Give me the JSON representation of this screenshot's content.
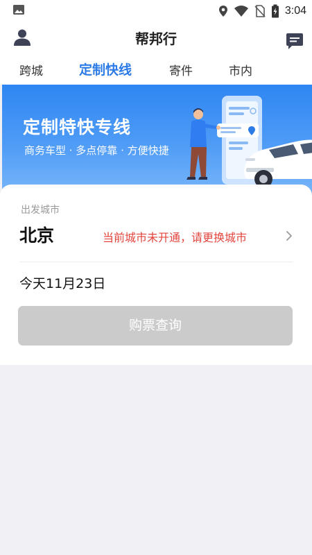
{
  "status_bar": {
    "time": "3:04",
    "icons": [
      "gallery-icon",
      "location-icon",
      "wifi-icon",
      "no-sim-icon",
      "battery-icon"
    ]
  },
  "header": {
    "title": "帮邦行",
    "left_icon": "user-icon",
    "right_icon": "message-icon"
  },
  "tabs": [
    {
      "label": "跨城",
      "active": false
    },
    {
      "label": "定制快线",
      "active": true
    },
    {
      "label": "寄件",
      "active": false
    },
    {
      "label": "市内",
      "active": false
    }
  ],
  "banner": {
    "title": "定制特快专线",
    "subtitle": "商务车型 · 多点停靠 · 方便快捷"
  },
  "form": {
    "departure_label": "出发城市",
    "departure_city": "北京",
    "city_warning": "当前城市未开通，请更换城市",
    "date": "今天11月23日",
    "query_button": "购票查询"
  },
  "colors": {
    "accent": "#2d7be6",
    "warning": "#e2453c",
    "disabled_button": "#cbcbcb",
    "banner": "#3a8cf4"
  }
}
